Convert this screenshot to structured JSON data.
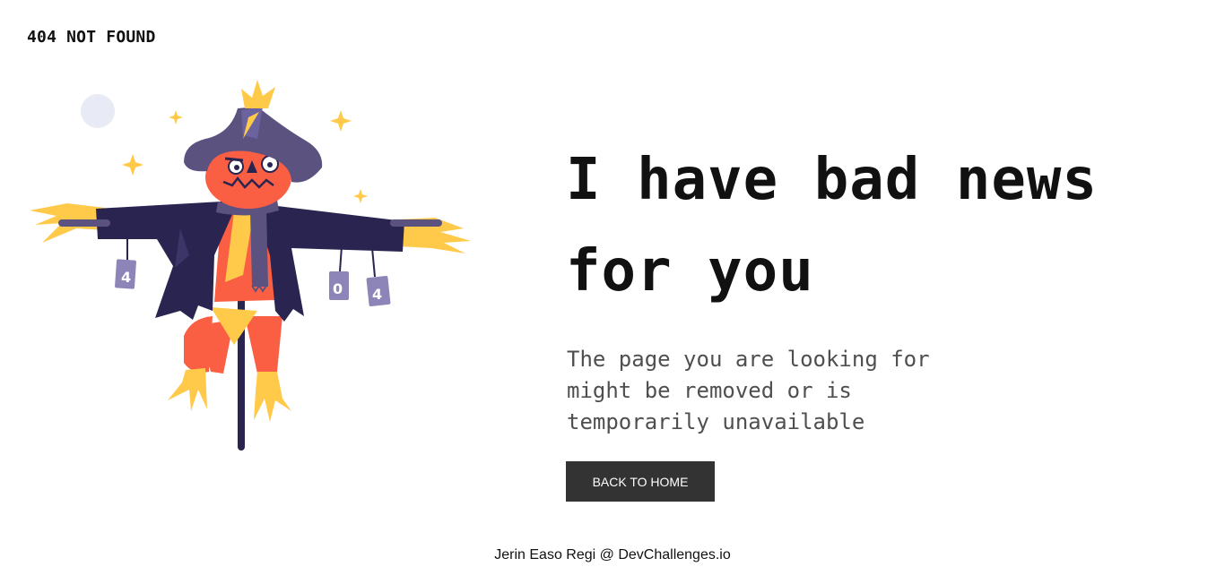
{
  "header": {
    "brand": "404 NOT FOUND"
  },
  "illustration": {
    "name": "scarecrow",
    "can_labels": [
      "4",
      "0",
      "4"
    ]
  },
  "main": {
    "headline": "I have bad news for you",
    "message": "The page you are looking for might be removed or is temporarily unavailable",
    "button_label": "BACK TO HOME"
  },
  "footer": {
    "credit": "Jerin Easo Regi @ DevChallenges.io"
  },
  "colors": {
    "text": "#111111",
    "muted_text": "#4f4f4f",
    "button": "#333333",
    "hat": "#5b5280",
    "coat": "#2a2550",
    "straw": "#ffc94a",
    "face": "#fa5f44"
  }
}
